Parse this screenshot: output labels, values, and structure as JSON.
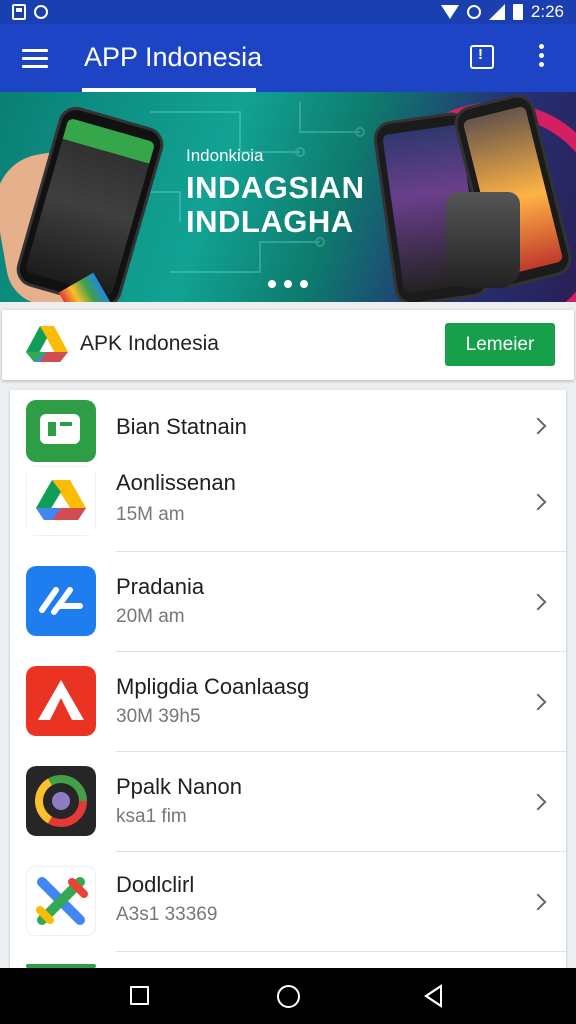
{
  "status_bar": {
    "time": "2:26"
  },
  "app_bar": {
    "title": "APP Indonesia"
  },
  "banner": {
    "small_text": "Indonkioia",
    "line1": "INDAGSIAN",
    "line2": "INDLAGHA",
    "slide_count": 3
  },
  "featured": {
    "title": "APK Indonesia",
    "button_label": "Lemeier",
    "accent": "#16a04a"
  },
  "apps": [
    {
      "name": "Bian Statnain",
      "meta": "",
      "icon": "green-chat-app-icon"
    },
    {
      "name": "Aonlissenan",
      "meta": "15M am",
      "icon": "drive-triangle-icon"
    },
    {
      "name": "Pradania",
      "meta": "20M am",
      "icon": "blue-link-app-icon"
    },
    {
      "name": "Mpligdia Coanlaasg",
      "meta": "30M 39h5",
      "icon": "red-a-app-icon"
    },
    {
      "name": "Ppalk Nanon",
      "meta": "ksa1 fim",
      "icon": "chrome-ring-icon"
    },
    {
      "name": "Dodlclirl",
      "meta": "A3s1 33369",
      "icon": "colorful-x-app-icon"
    }
  ],
  "colors": {
    "primary": "#1e44c6",
    "status_bar": "#1a3fb0"
  }
}
